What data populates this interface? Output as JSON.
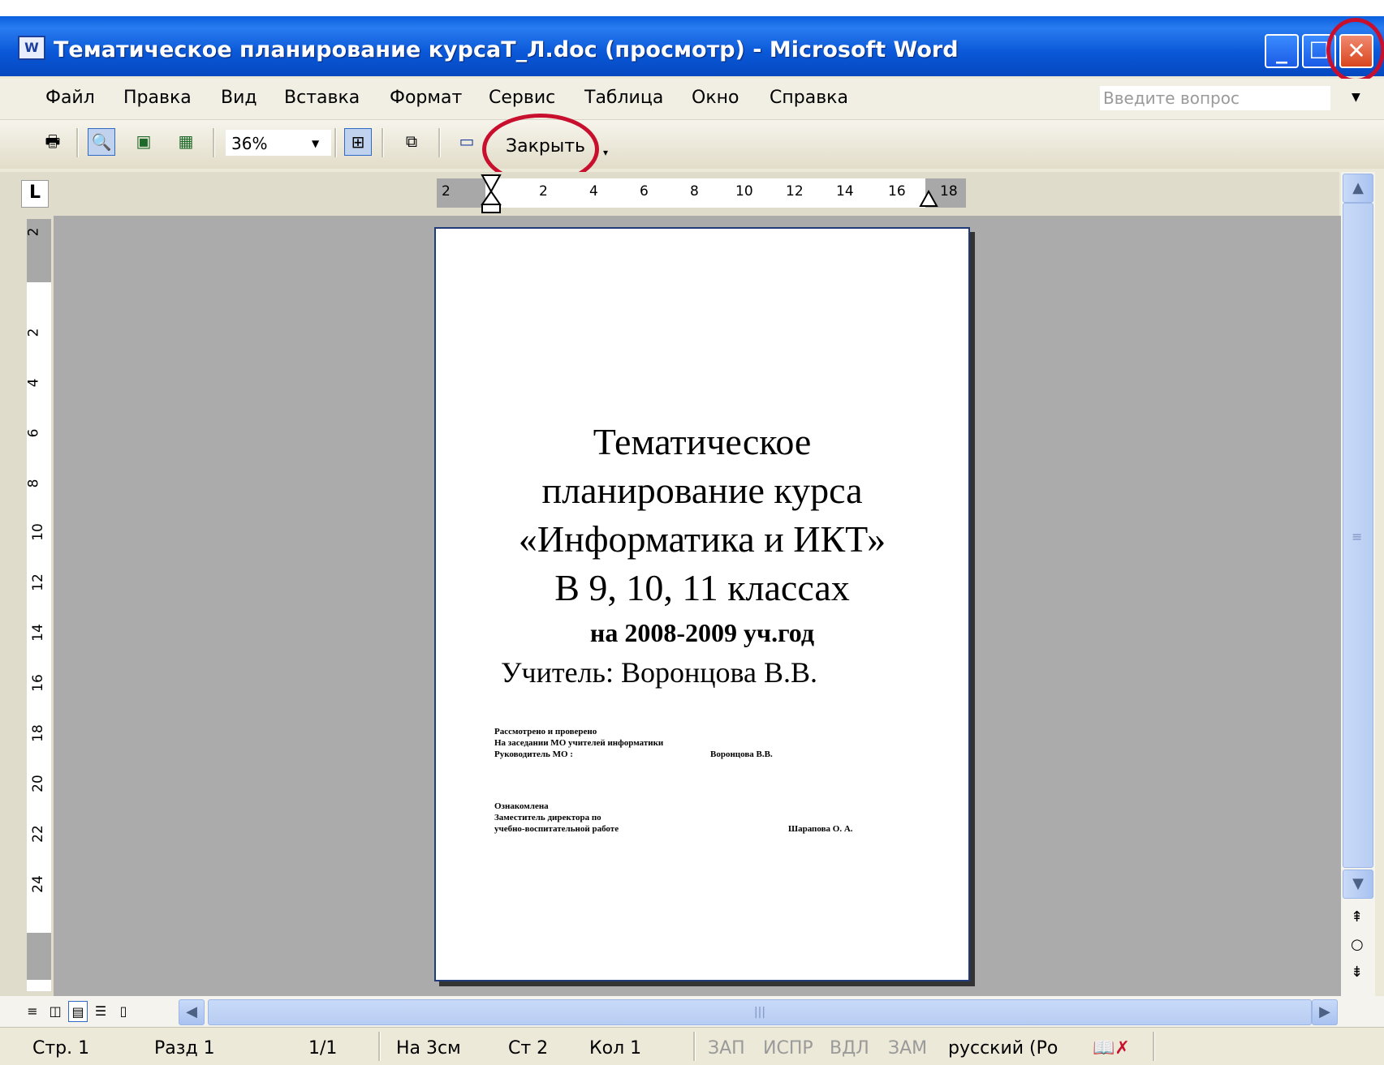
{
  "window": {
    "title": "Тематическое планирование курсаТ_Л.doc (просмотр) - Microsoft Word",
    "app_icon": "word-doc-icon",
    "minimize_icon": "minimize-icon",
    "maximize_icon": "maximize-icon",
    "close_icon": "close-icon"
  },
  "menubar": {
    "items": [
      "Файл",
      "Правка",
      "Вид",
      "Вставка",
      "Формат",
      "Сервис",
      "Таблица",
      "Окно",
      "Справка"
    ],
    "ask_placeholder": "Введите вопрос"
  },
  "toolbar": {
    "zoom": "36%",
    "close_label": "Закрыть",
    "buttons": [
      "print-icon",
      "magnifier-icon",
      "one-page-icon",
      "multiple-pages-icon",
      "zoom-dropdown",
      "shrink-to-fit-icon",
      "view-ruler-icon",
      "full-screen-icon",
      "close-preview-button"
    ]
  },
  "ruler": {
    "horizontal": [
      "2",
      "2",
      "4",
      "6",
      "8",
      "10",
      "12",
      "14",
      "16",
      "18"
    ],
    "vertical": [
      "2",
      "2",
      "4",
      "6",
      "8",
      "10",
      "12",
      "14",
      "16",
      "18",
      "20",
      "22",
      "24"
    ]
  },
  "document": {
    "title_line1": "Тематическое",
    "title_line2": "планирование курса",
    "title_line3": "«Информатика и ИКТ»",
    "title_line4": "В 9, 10, 11 классах",
    "year_line": "на 2008-2009 уч.год",
    "teacher_line": "Учитель: Воронцова В.В.",
    "block1_line1": "Рассмотрено и проверено",
    "block1_line2": "На заседании МО учителей информатики",
    "block1_line3": "Руководитель МО :",
    "block1_sign": "Воронцова В.В.",
    "block2_line1": "Ознакомлена",
    "block2_line2": "Заместитель директора по",
    "block2_line3": "учебно-воспитательной работе",
    "block2_sign": "Шарапова О. А."
  },
  "statusbar": {
    "page": "Стр. 1",
    "section": "Разд 1",
    "pages": "1/1",
    "at": "На 3см",
    "line": "Ст 2",
    "col": "Кол 1",
    "rec": "ЗАП",
    "trk": "ИСПР",
    "ext": "ВДЛ",
    "ovr": "ЗАМ",
    "language": "русский (Ро",
    "spelling_icon": "spelling-check-icon"
  },
  "colors": {
    "titlebar": "#0a58d8",
    "highlight_ring": "#c8102e",
    "canvas": "#ababab"
  }
}
